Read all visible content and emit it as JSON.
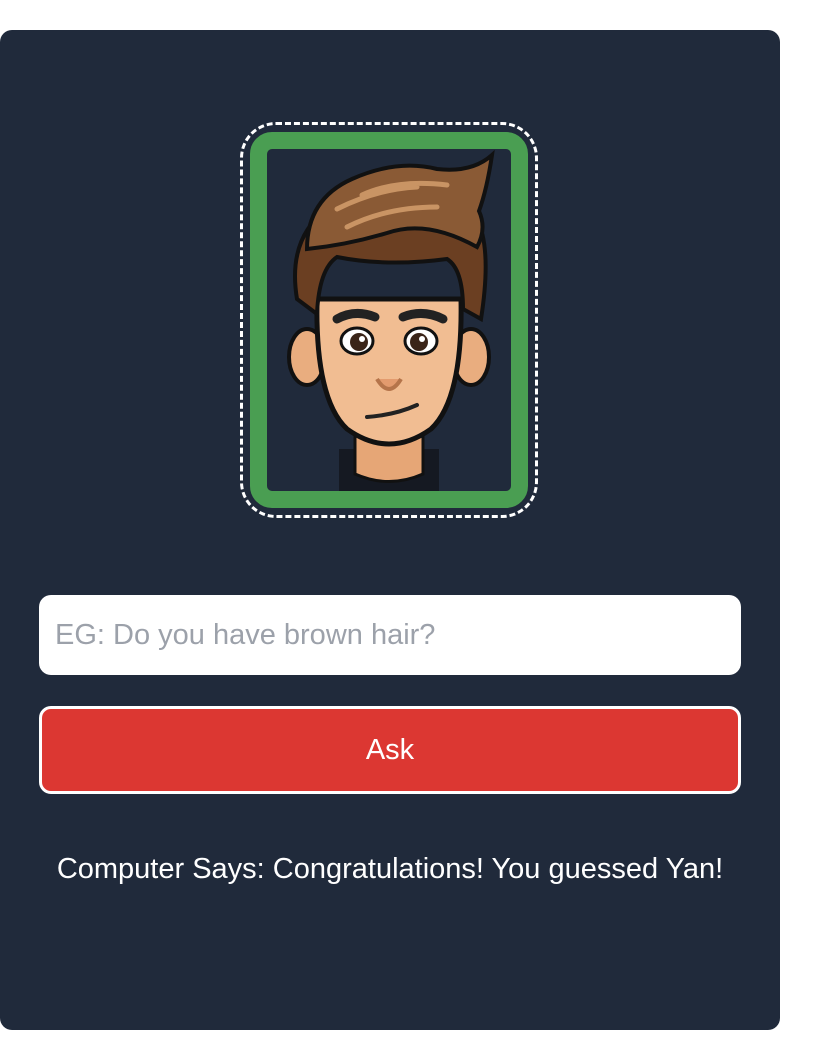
{
  "portrait": {
    "icon": "boy-cartoon-avatar",
    "frame_color": "#4a9e52",
    "outline_color": "#ffffff"
  },
  "question": {
    "value": "",
    "placeholder": "EG: Do you have brown hair?"
  },
  "ask_button": {
    "label": "Ask",
    "color": "#dc3732"
  },
  "response": {
    "text": "Computer Says: Congratulations! You guessed Yan!"
  },
  "colors": {
    "panel": "#202a3b",
    "page": "#ffffff"
  }
}
